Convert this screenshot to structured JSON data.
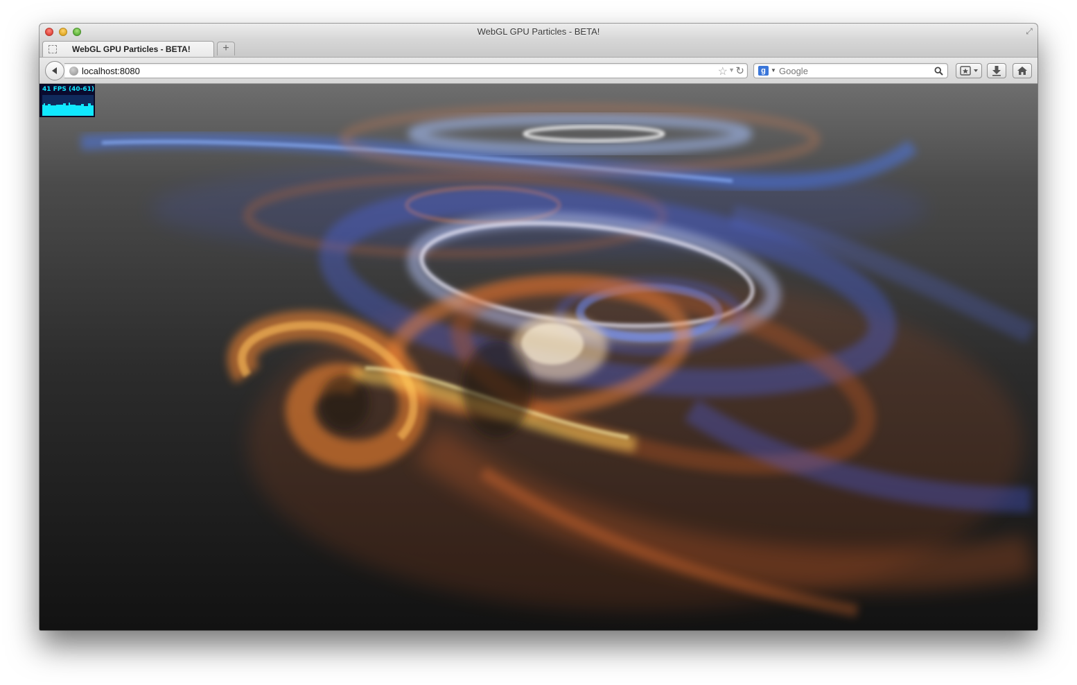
{
  "window": {
    "title": "WebGL GPU Particles - BETA!"
  },
  "tabs": [
    {
      "label": "WebGL GPU Particles - BETA!",
      "favicon": "placeholder-page-icon",
      "active": true
    }
  ],
  "newtab": {
    "label": "+"
  },
  "navbar": {
    "url": "localhost:8080",
    "search_placeholder": "Google",
    "search_engine": "google-g-icon",
    "icons": [
      "back-arrow-icon",
      "globe-icon",
      "bookmark-star-icon",
      "dropmarker-icon",
      "reload-icon",
      "search-magnifier-icon",
      "bookmarks-menu-icon",
      "downloads-icon",
      "home-icon"
    ]
  },
  "stats": {
    "fps_label": "41 FPS (40-61)",
    "colors": {
      "text": "#11e8ff",
      "background": "#0a0a2e",
      "bars": "#11e8ff"
    }
  },
  "scene": {
    "description_colors": {
      "warm": "#ff7a2a",
      "hot": "#ffd25a",
      "cool": "#4a78ff",
      "white": "#f4eaff"
    }
  }
}
